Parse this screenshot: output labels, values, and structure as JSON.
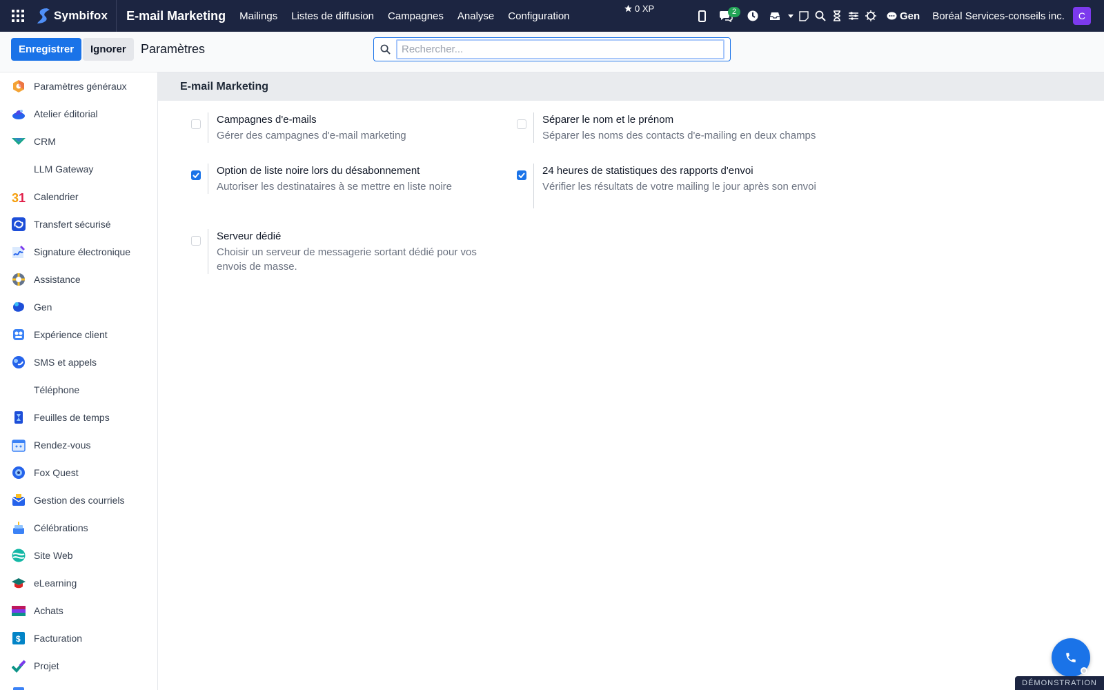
{
  "topbar": {
    "brand": "Symbifox",
    "app_title": "E-mail Marketing",
    "menu": [
      "Mailings",
      "Listes de diffusion",
      "Campagnes",
      "Analyse",
      "Configuration"
    ],
    "xp": "0 XP",
    "chat_badge": "2",
    "gen_label": "Gen",
    "company": "Boréal Services-conseils inc.",
    "avatar_letter": "C"
  },
  "control": {
    "save_label": "Enregistrer",
    "discard_label": "Ignorer",
    "breadcrumb": "Paramètres",
    "search_placeholder": "Rechercher..."
  },
  "sidebar": {
    "items": [
      {
        "label": "Paramètres généraux",
        "icon": "settings-icon"
      },
      {
        "label": "Atelier éditorial",
        "icon": "editorial-icon"
      },
      {
        "label": "CRM",
        "icon": "crm-icon"
      },
      {
        "label": "LLM Gateway",
        "icon": ""
      },
      {
        "label": "Calendrier",
        "icon": "calendar-icon"
      },
      {
        "label": "Transfert sécurisé",
        "icon": "transfer-icon"
      },
      {
        "label": "Signature électronique",
        "icon": "signature-icon"
      },
      {
        "label": "Assistance",
        "icon": "helpdesk-icon"
      },
      {
        "label": "Gen",
        "icon": "gen-icon"
      },
      {
        "label": "Expérience client",
        "icon": "customer-icon"
      },
      {
        "label": "SMS et appels",
        "icon": "sms-icon"
      },
      {
        "label": "Téléphone",
        "icon": ""
      },
      {
        "label": "Feuilles de temps",
        "icon": "timesheet-icon"
      },
      {
        "label": "Rendez-vous",
        "icon": "appointment-icon"
      },
      {
        "label": "Fox Quest",
        "icon": "quest-icon"
      },
      {
        "label": "Gestion des courriels",
        "icon": "mail-icon"
      },
      {
        "label": "Célébrations",
        "icon": "cake-icon"
      },
      {
        "label": "Site Web",
        "icon": "website-icon"
      },
      {
        "label": "eLearning",
        "icon": "elearning-icon"
      },
      {
        "label": "Achats",
        "icon": "purchase-icon"
      },
      {
        "label": "Facturation",
        "icon": "invoice-icon"
      },
      {
        "label": "Projet",
        "icon": "project-icon"
      }
    ]
  },
  "main": {
    "section_title": "E-mail Marketing",
    "settings": [
      {
        "title": "Campagnes d'e-mails",
        "desc": "Gérer des campagnes d'e-mail marketing",
        "checked": false
      },
      {
        "title": "Séparer le nom et le prénom",
        "desc": "Séparer les noms des contacts d'e-mailing en deux champs",
        "checked": false
      },
      {
        "title": "Option de liste noire lors du désabonnement",
        "desc": "Autoriser les destinataires à se mettre en liste noire",
        "checked": true
      },
      {
        "title": "24 heures de statistiques des rapports d'envoi",
        "desc": "Vérifier les résultats de votre mailing le jour après son envoi",
        "checked": true
      },
      {
        "title": "Serveur dédié",
        "desc": "Choisir un serveur de messagerie sortant dédié pour vos envois de masse.",
        "checked": false
      }
    ]
  },
  "demo_label": "DÉMONSTRATION",
  "colors": {
    "navbar": "#1c2541",
    "primary": "#1a73e8",
    "avatar": "#7c3aed",
    "badge": "#22a356"
  }
}
